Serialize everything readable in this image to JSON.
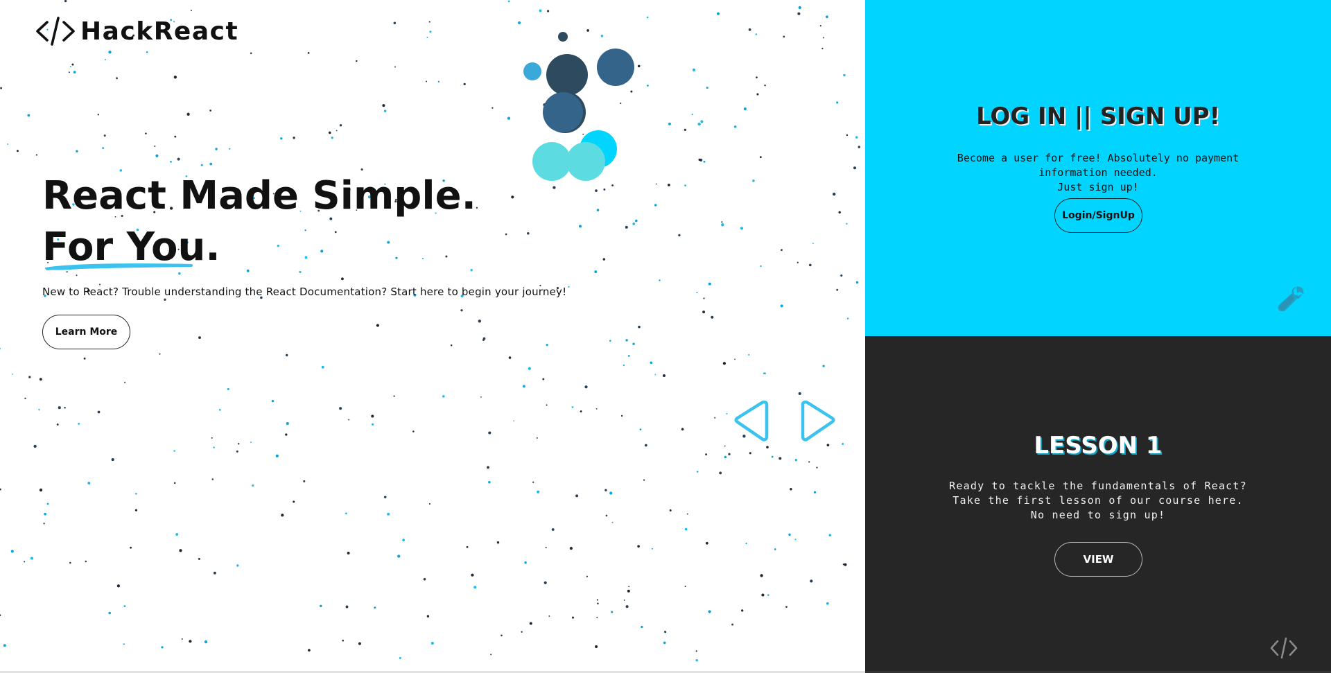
{
  "brand": {
    "name": "HackReact",
    "icon": "code-icon"
  },
  "hero": {
    "headline_line1": "React Made Simple.",
    "headline_line2_underlined": "For You",
    "headline_line2_period": ".",
    "subtext": "New to React? Trouble understanding the React Documentation? Start here to begin your journey!",
    "cta_label": "Learn More"
  },
  "carousel": {
    "prev_icon": "chevron-left-icon",
    "next_icon": "chevron-right-icon"
  },
  "signup": {
    "title": "LOG IN || SIGN UP!",
    "desc_lines": [
      "Become a user for free! Absolutely no payment information needed.",
      "Just sign up!"
    ],
    "button_label": "Login/SignUp",
    "icon": "wrench-icon"
  },
  "lesson": {
    "title": "LESSON 1",
    "desc_lines": [
      "Ready to tackle the fundamentals of React?",
      "Take the first lesson of our course here.",
      "No need to sign up!"
    ],
    "button_label": "VIEW",
    "icon": "code-icon"
  },
  "colors": {
    "accent_cyan": "#00d4ff",
    "dark_panel": "#262626",
    "bubble_navy": "#2e4a5e",
    "bubble_blue": "#34648a",
    "bubble_teal": "#5cdce0",
    "arrow_blue": "#3cc2ee"
  }
}
